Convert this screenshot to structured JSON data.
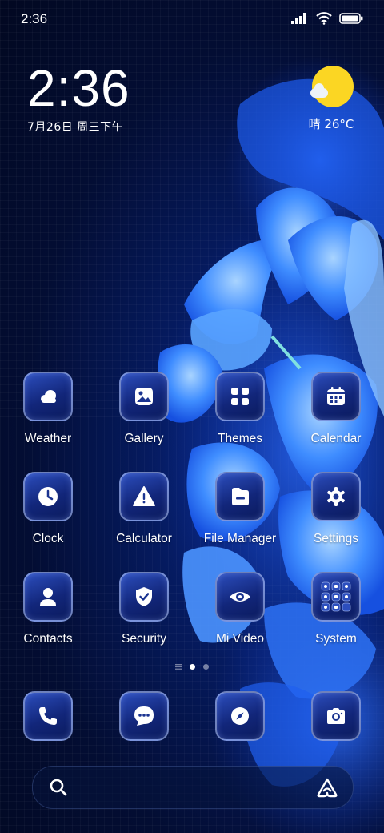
{
  "status_bar": {
    "time": "2:36"
  },
  "clock_widget": {
    "time": "2:36",
    "date": "7月26日 周三下午"
  },
  "weather_widget": {
    "text": "晴 26°C"
  },
  "apps": [
    {
      "label": "Weather",
      "icon": "weather-icon"
    },
    {
      "label": "Gallery",
      "icon": "gallery-icon"
    },
    {
      "label": "Themes",
      "icon": "themes-icon"
    },
    {
      "label": "Calendar",
      "icon": "calendar-icon"
    },
    {
      "label": "Clock",
      "icon": "clock-icon"
    },
    {
      "label": "Calculator",
      "icon": "calculator-icon"
    },
    {
      "label": "File Manager",
      "icon": "file-manager-icon"
    },
    {
      "label": "Settings",
      "icon": "settings-icon"
    },
    {
      "label": "Contacts",
      "icon": "contacts-icon"
    },
    {
      "label": "Security",
      "icon": "security-icon"
    },
    {
      "label": "Mi Video",
      "icon": "mi-video-icon"
    },
    {
      "label": "System",
      "icon": "system-folder-icon"
    }
  ],
  "page_indicator": {
    "pages": 2,
    "current": 1
  },
  "dock": [
    {
      "icon": "phone-icon"
    },
    {
      "icon": "messages-icon"
    },
    {
      "icon": "browser-icon"
    },
    {
      "icon": "camera-icon"
    }
  ],
  "colors": {
    "icon_bg": "#1a3390",
    "sun": "#fbd623",
    "accent_blue": "#2d6cf5"
  }
}
